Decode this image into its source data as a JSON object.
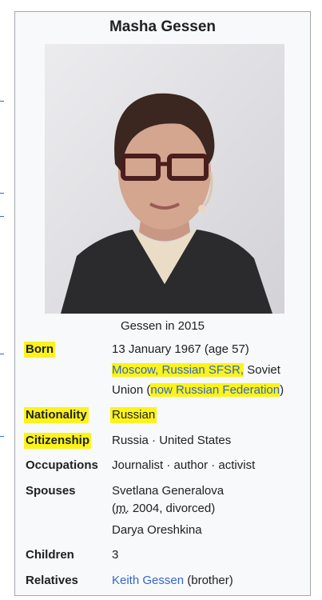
{
  "title": "Masha Gessen",
  "image_caption": "Gessen in 2015",
  "highlight_color": "#fbf31a",
  "link_color": "#3366cc",
  "rows": {
    "born": {
      "label": "Born",
      "date": "13 January 1967 (age 57)",
      "place_link": "Moscow, Russian SFSR,",
      "place_rest_1": " Soviet",
      "place_rest_2": "Union (",
      "note": "now Russian Federation",
      "close_paren": ")"
    },
    "nationality": {
      "label": "Nationality",
      "value": "Russian"
    },
    "citizenship": {
      "label": "Citizenship",
      "value_1": "Russia",
      "sep": " · ",
      "value_2": "United States"
    },
    "occupations": {
      "label": "Occupations",
      "value": "Journalist · author · activist"
    },
    "spouses": {
      "label": "Spouses",
      "spouse_1": "Svetlana Generalova",
      "married_prefix": "(",
      "married_abbr": "m.",
      "married_rest": " 2004, divorced)",
      "spouse_2": "Darya Oreshkina"
    },
    "children": {
      "label": "Children",
      "value": "3"
    },
    "relatives": {
      "label": "Relatives",
      "link": "Keith Gessen",
      "rest": " (brother)"
    }
  }
}
